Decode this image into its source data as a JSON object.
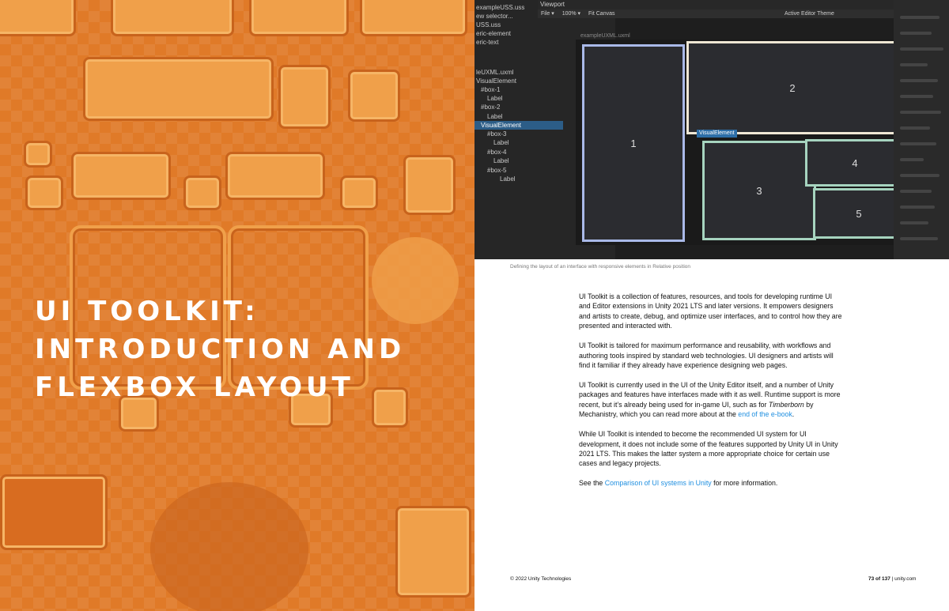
{
  "cover": {
    "title_lines": [
      "UI TOOLKIT:",
      "INTRODUCTION AND",
      "FLEXBOX LAYOUT"
    ]
  },
  "screenshot": {
    "tree_rows": [
      {
        "text": "exampleUSS.uss",
        "selected": false
      },
      {
        "text": "ew selector...",
        "selected": false
      },
      {
        "text": "USS.uss",
        "selected": false
      },
      {
        "text": "eric-element",
        "selected": false
      },
      {
        "text": "eric-text",
        "selected": false
      },
      {
        "text": "",
        "selected": false
      },
      {
        "text": "leUXML.uxml",
        "selected": false
      },
      {
        "text": "VisualElement",
        "selected": false
      },
      {
        "text": "#box-1",
        "selected": false
      },
      {
        "text": "Label",
        "selected": false
      },
      {
        "text": "#box-2",
        "selected": false
      },
      {
        "text": "Label",
        "selected": false
      },
      {
        "text": "VisualElement",
        "selected": true
      },
      {
        "text": "#box-3",
        "selected": false
      },
      {
        "text": "Label",
        "selected": false
      },
      {
        "text": "#box-4",
        "selected": false
      },
      {
        "text": "Label",
        "selected": false
      },
      {
        "text": "#box-5",
        "selected": false
      },
      {
        "text": "Label",
        "selected": false
      }
    ],
    "viewport_title": "Viewport",
    "toolbar": {
      "file": "File ▾",
      "zoom": "100% ▾",
      "fit": "Fit Canvas",
      "theme": "Active Editor Theme"
    },
    "canvas_label": "exampleUXML.uxml",
    "ve_tag": "VisualElement",
    "boxes": [
      "1",
      "2",
      "3",
      "4",
      "5"
    ]
  },
  "caption": "Defining the layout of an interface with responsive elements in Relative position",
  "body": {
    "p1": "UI Toolkit is a collection of features, resources, and tools for developing runtime UI and Editor extensions in Unity 2021 LTS and later versions. It empowers designers and artists to create, debug, and optimize user interfaces, and to control how they are presented and interacted with.",
    "p2": "UI Toolkit is tailored for maximum performance and reusability, with workflows and authoring tools inspired by standard web technologies. UI designers and artists will find it familiar if they already have experience designing web pages.",
    "p3_a": "UI Toolkit is currently used in the UI of the Unity Editor itself, and a number of Unity packages and features have interfaces made with it as well. Runtime support is more recent, but it’s already being used for in-game UI, such as for ",
    "p3_em": "Timberborn",
    "p3_b": " by Mechanistry, which you can read more about at the ",
    "p3_link": "end of the e-book",
    "p3_c": ".",
    "p4": "While UI Toolkit is intended to become the recommended UI system for UI development, it does not include some of the features supported by Unity UI in Unity 2021 LTS. This makes the latter system a more appropriate choice for certain use cases and legacy projects.",
    "p5_a": "See the ",
    "p5_link": "Comparison of UI systems in Unity",
    "p5_b": " for more information."
  },
  "footer": {
    "copyright": "© 2022 Unity Technologies",
    "page": "73 of 137",
    "sep": " | ",
    "site": "unity.com"
  },
  "colors": {
    "orange": "#e07a28",
    "link": "#1f8fe0"
  }
}
